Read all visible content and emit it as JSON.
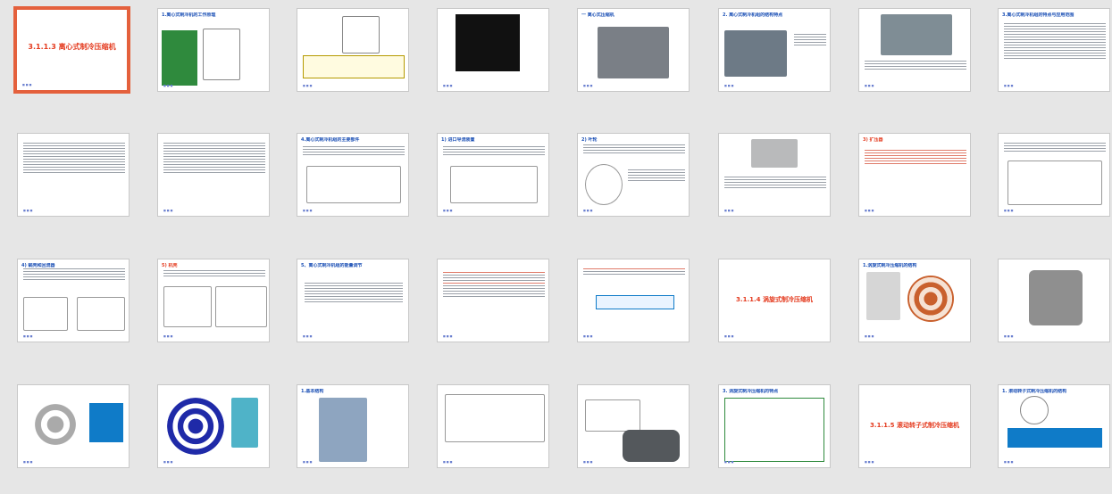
{
  "slides": [
    {
      "title": "3.1.1.3  离心式制冷压缩机",
      "kind": "title",
      "selected": true
    },
    {
      "title": "1.离心式制冷机的工作原理",
      "kind": "text-green"
    },
    {
      "title": "",
      "kind": "diagram-yellow"
    },
    {
      "title": "",
      "kind": "photo-dark"
    },
    {
      "title": "一  离心式压缩机",
      "kind": "photo"
    },
    {
      "title": "2. 离心式制冷机组的结构特点",
      "kind": "photo-text"
    },
    {
      "title": "",
      "kind": "photo-text"
    },
    {
      "title": "3.离心式制冷机组的特点与应用范围",
      "kind": "text"
    },
    {
      "title": "",
      "kind": "text"
    },
    {
      "title": "",
      "kind": "text"
    },
    {
      "title": "4.离心式制冷机组的主要部件",
      "kind": "diagram"
    },
    {
      "title": "1) 进口导流装置",
      "kind": "diagram"
    },
    {
      "title": "2) 叶轮",
      "kind": "diagram"
    },
    {
      "title": "",
      "kind": "photo-text"
    },
    {
      "title": "3) 扩压器",
      "kind": "text-red"
    },
    {
      "title": "",
      "kind": "diagram"
    },
    {
      "title": "4) 蜗壳和回流器",
      "kind": "diagram"
    },
    {
      "title": "5) 机壳",
      "kind": "diagram"
    },
    {
      "title": "5、离心式制冷机组的能量调节",
      "kind": "text"
    },
    {
      "title": "",
      "kind": "text"
    },
    {
      "title": "",
      "kind": "text"
    },
    {
      "title": "3.1.1.4  涡旋式制冷压缩机",
      "kind": "title"
    },
    {
      "title": "1.涡旋式制冷压缩机的结构",
      "kind": "diagram"
    },
    {
      "title": "",
      "kind": "photo"
    },
    {
      "title": "",
      "kind": "diagram"
    },
    {
      "title": "",
      "kind": "diagram"
    },
    {
      "title": "1.基本结构",
      "kind": "diagram"
    },
    {
      "title": "",
      "kind": "diagram"
    },
    {
      "title": "",
      "kind": "photo"
    },
    {
      "title": "3. 涡旋式制冷压缩机的特点",
      "kind": "text"
    },
    {
      "title": "3.1.1.5  滚动转子式制冷压缩机",
      "kind": "title"
    },
    {
      "title": "1. 滚动转子式制冷压缩机的结构",
      "kind": "diagram"
    }
  ]
}
